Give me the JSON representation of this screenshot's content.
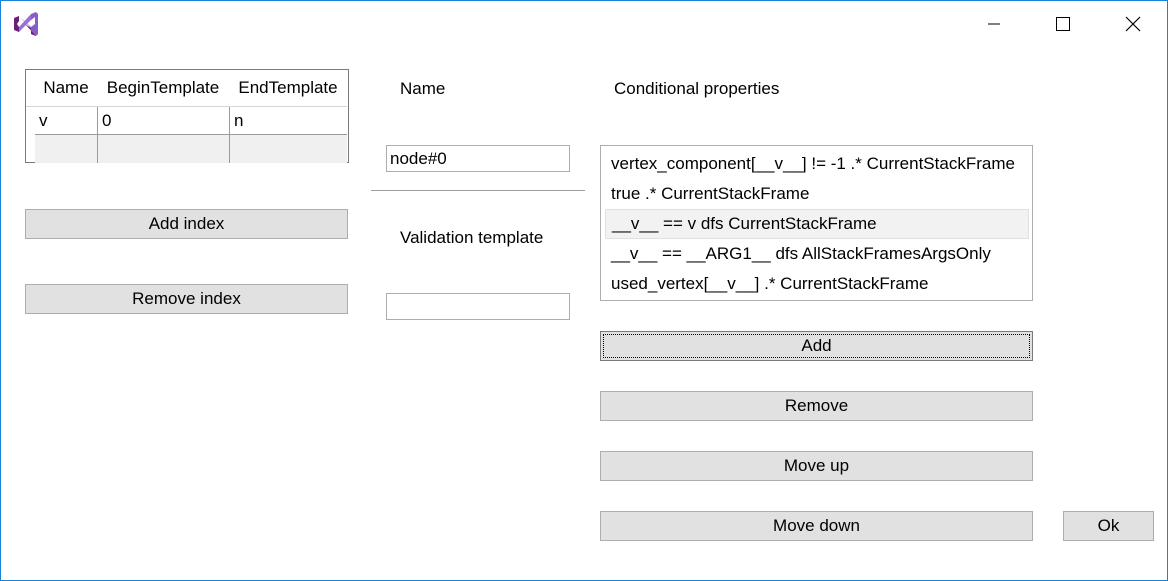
{
  "titlebar": {
    "logo_icon": "visual-studio-logo-icon",
    "minimize_icon": "minimize-icon",
    "maximize_icon": "maximize-icon",
    "close_icon": "close-icon"
  },
  "grid": {
    "columns": [
      "Name",
      "BeginTemplate",
      "EndTemplate"
    ],
    "rows": [
      [
        "v",
        "0",
        "n"
      ]
    ]
  },
  "left_buttons": {
    "add_index": "Add index",
    "remove_index": "Remove index"
  },
  "middle": {
    "name_label": "Name",
    "name_value": "node#0",
    "validation_label": "Validation template",
    "validation_value": ""
  },
  "conditional": {
    "label": "Conditional properties",
    "items": [
      "vertex_component[__v__] != -1 .* CurrentStackFrame",
      "true .* CurrentStackFrame",
      "__v__ == v dfs CurrentStackFrame",
      "__v__ == __ARG1__ dfs AllStackFramesArgsOnly",
      "used_vertex[__v__] .* CurrentStackFrame"
    ],
    "selected_index": 2
  },
  "buttons": {
    "add": "Add",
    "remove": "Remove",
    "move_up": "Move up",
    "move_down": "Move down",
    "ok": "Ok"
  },
  "colors": {
    "window_border": "#1883d7",
    "logo": "#865fc5",
    "button_face": "#e1e1e1"
  }
}
